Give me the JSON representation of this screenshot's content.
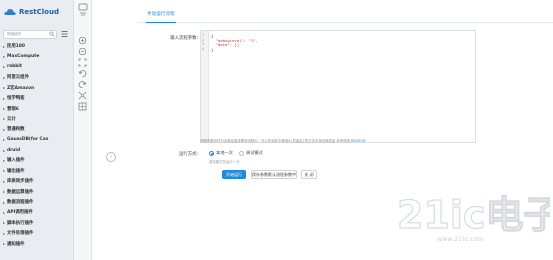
{
  "app": {
    "logo_text": "RestCloud"
  },
  "sidebar": {
    "search_placeholder": "搜索组件",
    "items": [
      {
        "label": "民用180"
      },
      {
        "label": "MaxCompute"
      },
      {
        "label": "rabbit"
      },
      {
        "label": "阿里云组件"
      },
      {
        "label": "Z宏Amazon"
      },
      {
        "label": "恒学鸭客"
      },
      {
        "label": "营销6"
      },
      {
        "label": "云计"
      },
      {
        "label": "普通构数"
      },
      {
        "label": "GaussDB(for Cas"
      },
      {
        "label": "druid"
      },
      {
        "label": "输入插件"
      },
      {
        "label": "输出插件"
      },
      {
        "label": "库表同步插件"
      },
      {
        "label": "数据运算插件"
      },
      {
        "label": "数据流程插件"
      },
      {
        "label": "API调用插件"
      },
      {
        "label": "脚本执行插件"
      },
      {
        "label": "文件处理插件"
      },
      {
        "label": "通知插件"
      }
    ]
  },
  "tab": {
    "label": "手动运行流程"
  },
  "form": {
    "param_label": "输入流程参数:",
    "code_lines": [
      {
        "num": "1",
        "text": "{"
      },
      {
        "num": "2",
        "text": "  \"debugLevel\": \"1\","
      },
      {
        "num": "3",
        "text": "  \"data\": []"
      },
      {
        "num": "4",
        "text": "}"
      }
    ],
    "help_text": "流程参数将作为全局变量设置到流程中，可以在组件中使用${变量名}的方式引用全局变量 参考说明",
    "help_link": "REDSON",
    "mode_label": "运行方式:",
    "mode_options": [
      "本地一次",
      "调试模式"
    ],
    "mode_hint": "调试模式仅运行一次",
    "buttons": {
      "run": "开始运行",
      "save": "保存参数默认流程参数中",
      "close": "关 闭"
    }
  },
  "watermark": {
    "big": "21ic电子网",
    "domain": "www.21ic.com"
  }
}
